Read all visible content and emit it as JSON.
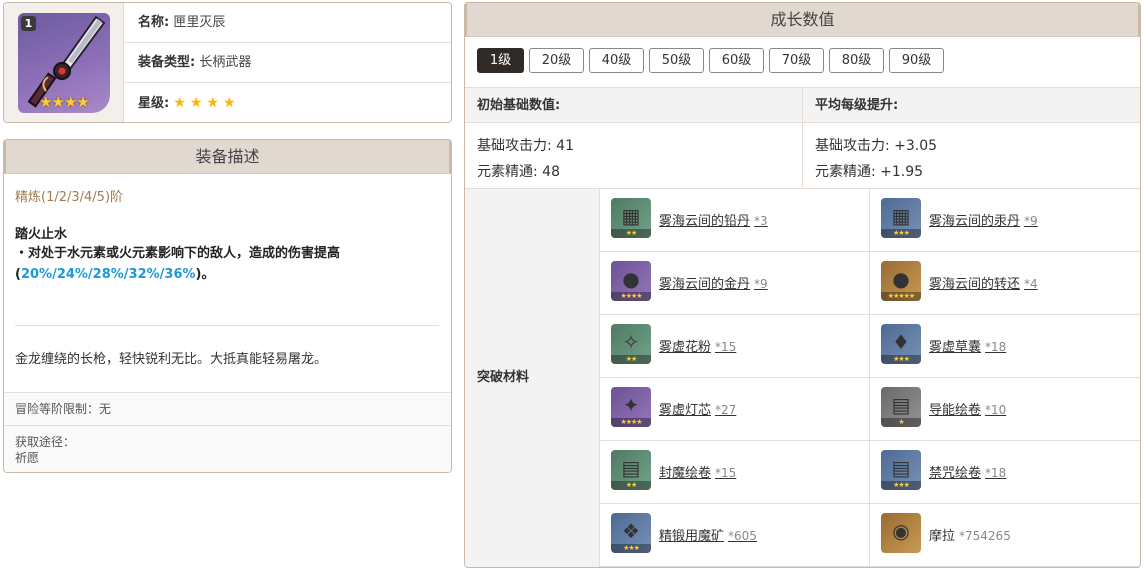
{
  "info": {
    "badge_level": "1",
    "portrait_stars": "★★★★",
    "name_label": "名称:",
    "name_value": "匣里灭辰",
    "type_label": "装备类型:",
    "type_value": "长柄武器",
    "rarity_label": "星级:",
    "rarity_value": "★★★★",
    "rarity_stars": 4
  },
  "description": {
    "title": "装备描述",
    "refine": "精炼(1/2/3/4/5)阶",
    "passive_name": "踏火止水",
    "passive_prefix": "・对处于水元素或火元素影响下的敌人，造成的伤害提高(",
    "passive_values": "20%/24%/28%/32%/36%",
    "passive_suffix": ")。",
    "lore": "金龙缠绕的长枪，轻快锐利无比。大抵真能轻易屠龙。",
    "ar_limit": "冒险等阶限制：无",
    "source_label": "获取途径：",
    "source_value": "祈愿"
  },
  "stats": {
    "title": "成长数值",
    "levels": [
      "1级",
      "20级",
      "40级",
      "50级",
      "60级",
      "70级",
      "80级",
      "90级"
    ],
    "active_level": "1级",
    "initial_label": "初始基础数值:",
    "growth_label": "平均每级提升:",
    "initial_atk": "基础攻击力: 41",
    "initial_em": "元素精通: 48",
    "growth_atk": "基础攻击力: +3.05",
    "growth_em": "元素精通: +1.95",
    "materials_label": "突破材料",
    "materials": [
      {
        "name": "雾海云间的铅丹",
        "count": "*3",
        "stars": "★★",
        "glyph": "▦",
        "rarity": 2
      },
      {
        "name": "雾海云间的汞丹",
        "count": "*9",
        "stars": "★★★",
        "glyph": "▦",
        "rarity": 3
      },
      {
        "name": "雾海云间的金丹",
        "count": "*9",
        "stars": "★★★★",
        "glyph": "●",
        "rarity": 4
      },
      {
        "name": "雾海云间的转还",
        "count": "*4",
        "stars": "★★★★★",
        "glyph": "●",
        "rarity": 5
      },
      {
        "name": "雾虚花粉",
        "count": "*15",
        "stars": "★★",
        "glyph": "✧",
        "rarity": 2
      },
      {
        "name": "雾虚草囊",
        "count": "*18",
        "stars": "★★★",
        "glyph": "♦",
        "rarity": 3
      },
      {
        "name": "雾虚灯芯",
        "count": "*27",
        "stars": "★★★★",
        "glyph": "✦",
        "rarity": 4
      },
      {
        "name": "导能绘卷",
        "count": "*10",
        "stars": "★",
        "glyph": "▤",
        "rarity": 1
      },
      {
        "name": "封魔绘卷",
        "count": "*15",
        "stars": "★★",
        "glyph": "▤",
        "rarity": 2
      },
      {
        "name": "禁咒绘卷",
        "count": "*18",
        "stars": "★★★",
        "glyph": "▤",
        "rarity": 3
      },
      {
        "name": "精锻用魔矿",
        "count": "*605",
        "stars": "★★★",
        "glyph": "❖",
        "rarity": 3
      },
      {
        "name": "摩拉",
        "count": "*754265",
        "stars": "",
        "glyph": "◉",
        "rarity": 5,
        "plain": true
      }
    ]
  },
  "colors": {
    "accent_active": "#2f2a26",
    "header_bg": "#e1d9cf",
    "highlight_blue": "#1c9ad6",
    "refine_gold": "#a07c4f",
    "star_yellow": "#ffb400"
  }
}
